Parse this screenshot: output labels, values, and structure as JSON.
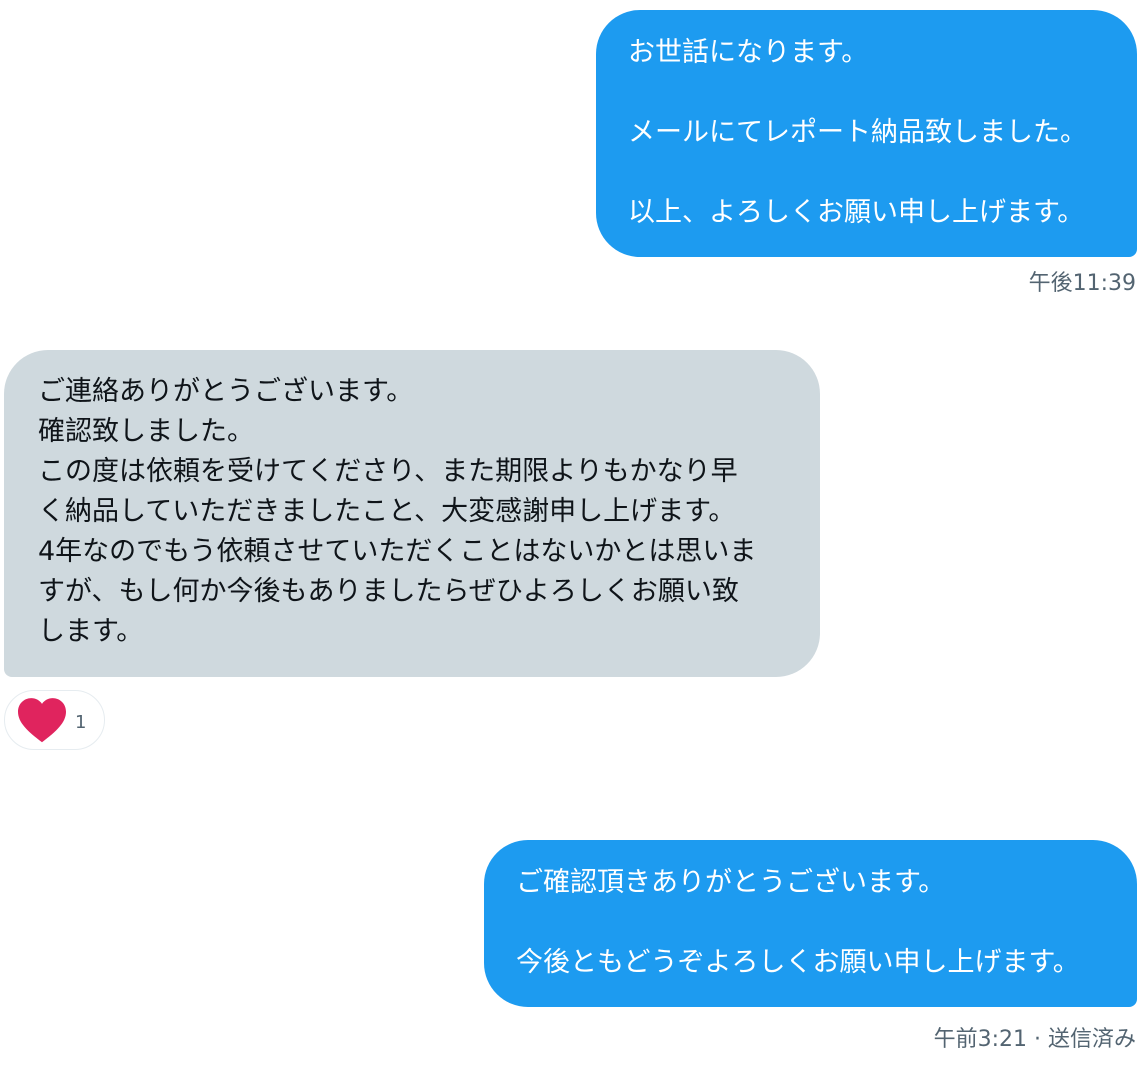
{
  "conversation": {
    "messages": [
      {
        "direction": "sent",
        "text": "お世話になります。\n\nメールにてレポート納品致しました。\n\n以上、よろしくお願い申し上げます。"
      },
      {
        "direction": "received",
        "text": "ご連絡ありがとうございます。\n確認致しました。\nこの度は依頼を受けてくださり、また期限よりもかなり早\nく納品していただきましたこと、大変感謝申し上げます。\n4年なのでもう依頼させていただくことはないかとは思いま\nすが、もし何か今後もありましたらぜひよろしくお願い致\nします。"
      },
      {
        "direction": "sent",
        "text": "ご確認頂きありがとうございます。\n\n今後ともどうぞよろしくお願い申し上げます。"
      }
    ],
    "timestamps": {
      "first": "午後11:39",
      "last": "午前3:21 · 送信済み"
    },
    "reaction": {
      "icon": "heart-icon",
      "color": "#e0245e",
      "count": "1"
    }
  },
  "colors": {
    "sent_bubble": "#1d9bf0",
    "received_bubble": "#cfd9de",
    "meta_text": "#536471"
  }
}
